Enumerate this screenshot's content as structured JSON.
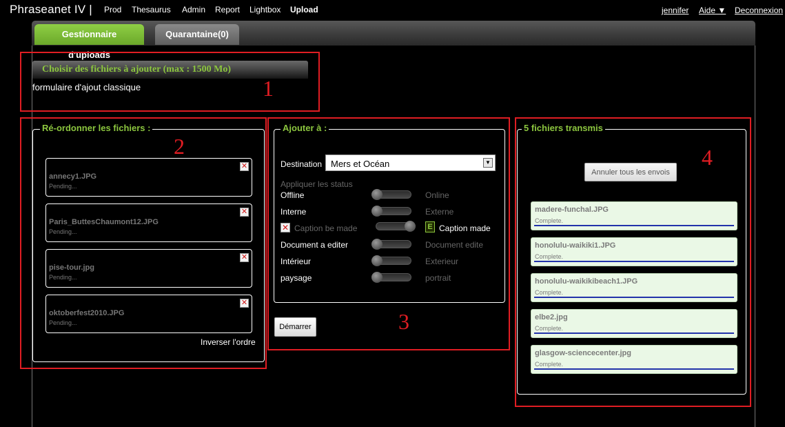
{
  "header": {
    "brand": "Phraseanet IV |",
    "nav": [
      "Prod",
      "Thesaurus",
      "Admin",
      "Report",
      "Lightbox",
      "Upload"
    ],
    "active_nav": "Upload",
    "user": "jennifer",
    "help": "Aide ▼",
    "logout": "Deconnexion"
  },
  "tabs": {
    "uploads": "Gestionnaire d'uploads",
    "quarantine": "Quarantaine(0)"
  },
  "section1": {
    "choose_label": "Choisir des fichiers à ajouter (max : 1500 Mo)",
    "classic_form": "formulaire d'ajout classique"
  },
  "reorder": {
    "legend": "Ré-ordonner les fichiers :",
    "files": [
      {
        "name": "annecy1.JPG",
        "status": "Pending..."
      },
      {
        "name": "Paris_ButtesChaumont12.JPG",
        "status": "Pending..."
      },
      {
        "name": "pise-tour.jpg",
        "status": "Pending..."
      },
      {
        "name": "oktoberfest2010.JPG",
        "status": "Pending..."
      }
    ],
    "invert": "Inverser l'ordre"
  },
  "add_to": {
    "legend": "Ajouter à :",
    "destination_label": "Destination",
    "destination_value": "Mers et Océan",
    "apply_status": "Appliquer les status",
    "toggles": [
      {
        "left": "Offline",
        "right": "Online",
        "value": 0
      },
      {
        "left": "Interne",
        "right": "Externe",
        "value": 0
      },
      {
        "left": "Caption be made",
        "right": "Caption made",
        "value": 1
      },
      {
        "left": "Document a editer",
        "right": "Document edite",
        "value": 0
      },
      {
        "left": "Intérieur",
        "right": "Exterieur",
        "value": 0
      },
      {
        "left": "paysage",
        "right": "portrait",
        "value": 0
      }
    ],
    "start": "Démarrer"
  },
  "transmitted": {
    "legend": "5 fichiers transmis",
    "cancel_all": "Annuler tous les envois",
    "files": [
      {
        "name": "madere-funchal.JPG",
        "status": "Complete.",
        "progress": 1
      },
      {
        "name": "honolulu-waikiki1.JPG",
        "status": "Complete.",
        "progress": 1
      },
      {
        "name": "honolulu-waikikibeach1.JPG",
        "status": "Complete.",
        "progress": 1
      },
      {
        "name": "elbe2.jpg",
        "status": "Complete.",
        "progress": 1
      },
      {
        "name": "glasgow-sciencecenter.jpg",
        "status": "Complete.",
        "progress": 1
      }
    ]
  },
  "annotations": [
    "1",
    "2",
    "3",
    "4"
  ],
  "colors": {
    "accent_green": "#8cc63f",
    "annotation_red": "#e01d23",
    "progress_blue": "#2233aa"
  }
}
